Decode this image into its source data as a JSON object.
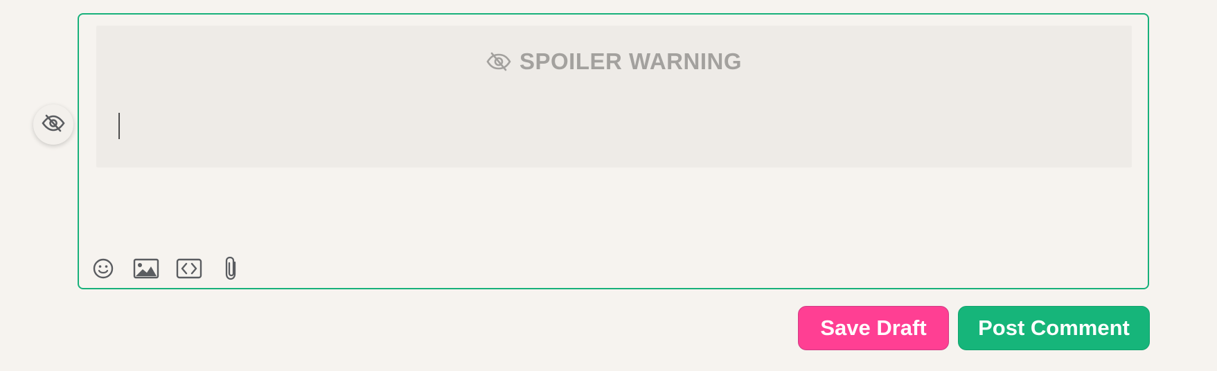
{
  "editor": {
    "spoiler_label": "SPOILER WARNING",
    "text_value": "",
    "toolbar": [
      {
        "icon": "smiley-icon"
      },
      {
        "icon": "image-icon"
      },
      {
        "icon": "code-icon"
      },
      {
        "icon": "paperclip-icon"
      }
    ]
  },
  "actions": {
    "save_draft_label": "Save Draft",
    "post_comment_label": "Post Comment"
  },
  "colors": {
    "accent_green": "#16b57a",
    "save_pink": "#ff3f93",
    "spoiler_text": "#a3a19e",
    "page_bg": "#f6f3ef"
  }
}
